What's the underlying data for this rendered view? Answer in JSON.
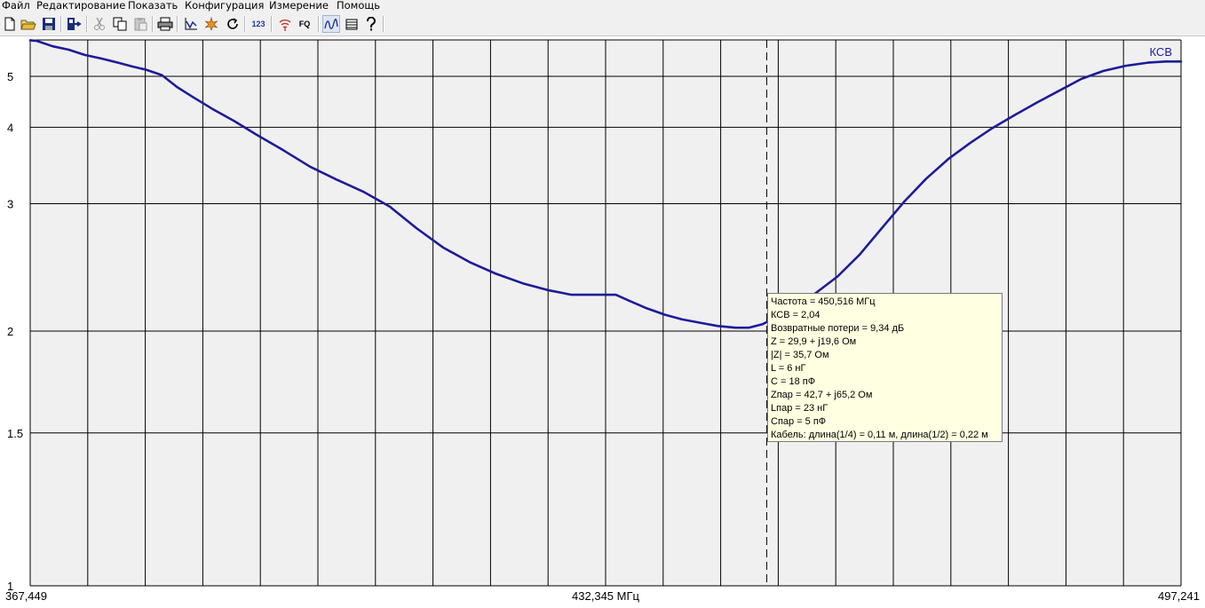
{
  "menu": [
    "Файл",
    "Редактирование",
    "Показать",
    "Конфигурация",
    "Измерение",
    "Помощь"
  ],
  "toolbar": {
    "buttons": [
      {
        "name": "new-file-icon",
        "enabled": true
      },
      {
        "name": "open-folder-icon",
        "enabled": true
      },
      {
        "name": "save-disk-icon",
        "enabled": true
      },
      {
        "name": "export-icon",
        "enabled": true
      },
      {
        "name": "cut-icon",
        "enabled": false
      },
      {
        "name": "copy-icon",
        "enabled": true
      },
      {
        "name": "paste-icon",
        "enabled": false
      },
      {
        "name": "print-icon",
        "enabled": true
      },
      {
        "name": "chart-view-icon",
        "enabled": true
      },
      {
        "name": "markers-icon",
        "enabled": true
      },
      {
        "name": "refresh-icon",
        "enabled": true
      },
      {
        "name": "numeric-view-icon",
        "enabled": true,
        "text": "123"
      },
      {
        "name": "wireless-icon",
        "enabled": true
      },
      {
        "name": "frequency-icon",
        "enabled": true,
        "text": "FQ"
      },
      {
        "name": "curve-mode-icon",
        "enabled": true,
        "pressed": true
      },
      {
        "name": "table-icon",
        "enabled": true
      },
      {
        "name": "help-icon",
        "enabled": true
      }
    ]
  },
  "chart_data": {
    "type": "line",
    "series": [
      {
        "name": "КСВ",
        "color": "#1c1c99",
        "x": [
          367.449,
          368.2,
          370.0,
          371.8,
          373.6,
          375.5,
          377.5,
          379.0,
          380.5,
          382.3,
          384.0,
          385.8,
          388.0,
          390.5,
          393.0,
          396.0,
          399.0,
          402.0,
          405.0,
          408.0,
          411.0,
          414.0,
          417.0,
          420.0,
          423.0,
          426.0,
          428.5,
          431.0,
          433.5,
          435.0,
          437.0,
          439.0,
          441.0,
          443.0,
          445.0,
          447.0,
          448.5,
          450.0,
          451.5,
          453.5,
          456.0,
          458.5,
          461.0,
          463.5,
          466.0,
          468.5,
          471.0,
          473.5,
          476.0,
          478.5,
          481.0,
          483.5,
          486.0,
          488.5,
          491.0,
          493.5,
          495.5,
          497.241
        ],
        "y": [
          5.99,
          5.97,
          5.8,
          5.7,
          5.55,
          5.45,
          5.33,
          5.24,
          5.16,
          5.03,
          4.76,
          4.55,
          4.32,
          4.1,
          3.88,
          3.65,
          3.43,
          3.27,
          3.13,
          2.97,
          2.76,
          2.59,
          2.47,
          2.38,
          2.31,
          2.26,
          2.23,
          2.23,
          2.23,
          2.19,
          2.14,
          2.1,
          2.07,
          2.05,
          2.03,
          2.02,
          2.02,
          2.04,
          2.08,
          2.14,
          2.24,
          2.36,
          2.53,
          2.76,
          3.02,
          3.28,
          3.53,
          3.76,
          3.99,
          4.21,
          4.44,
          4.68,
          4.94,
          5.13,
          5.26,
          5.34,
          5.37,
          5.37
        ]
      }
    ],
    "ylabel": "КСВ",
    "xlim": [
      367.449,
      497.241
    ],
    "yticks": [
      1,
      1.5,
      2,
      3,
      4,
      5
    ],
    "ytick_labels": [
      "1",
      "1.5",
      "2",
      "3",
      "4",
      "5"
    ],
    "ylim": [
      1,
      6
    ],
    "y_scale": "vswr-reflection (nonlinear)",
    "x_tick_labels": {
      "left": "367,449",
      "center": "432,345 МГц",
      "right": "497,241"
    },
    "grid": true,
    "grid_vertical_lines": 20,
    "cursor_x": 450.516,
    "cursor_readout": [
      "Частота = 450,516 МГц",
      "КСВ = 2,04",
      "Возвратные потери = 9,34 дБ",
      "Z = 29,9 + j19,6 Ом",
      "|Z| = 35,7 Ом",
      "L = 6 нГ",
      "C = 18 пФ",
      "Zпар = 42,7 + j65,2 Ом",
      "Lпар = 23 нГ",
      "Cпар = 5 пФ",
      "Кабель: длина(1/4) = 0,11 м, длина(1/2) = 0,22 м"
    ]
  },
  "colors": {
    "plot_bg": "#f0f0f0",
    "grid": "#000000",
    "series": "#1c1c99"
  }
}
